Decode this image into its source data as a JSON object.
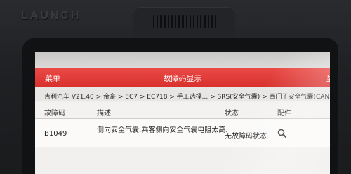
{
  "device": {
    "brand": "LAUNCH"
  },
  "app": {
    "menu_label": "菜单",
    "title": "故障码显示",
    "right_label": "显"
  },
  "breadcrumb": "吉利汽车 V21.40 > 帝豪 > EC7 > EC718 > 手工选择... > SRS(安全气囊) > 西门子安全气囊(CANBUS)",
  "table": {
    "columns": [
      "故障码",
      "描述",
      "状态",
      "配件"
    ],
    "rows": [
      {
        "code": "B1049",
        "description": "侧向安全气囊:乘客侧向安全气囊电阻太高.",
        "status": "无故障码状态",
        "part_icon": "search-icon"
      }
    ]
  },
  "colors": {
    "titlebar": "#d8302d",
    "screen_bg": "#f2f0ef",
    "bezel": "#1b1c1e"
  }
}
